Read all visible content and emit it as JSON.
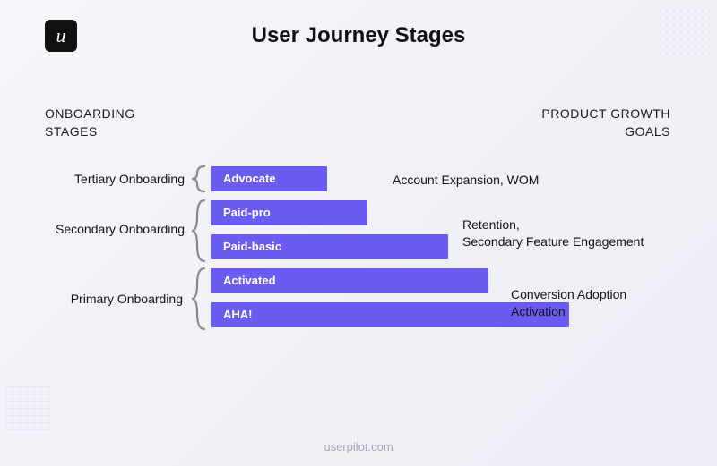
{
  "brand": {
    "logo_glyph": "u"
  },
  "title": "User Journey Stages",
  "columns": {
    "left": {
      "line1": "ONBOARDING",
      "line2": "STAGES"
    },
    "right": {
      "line1": "PRODUCT GROWTH",
      "line2": "GOALS"
    }
  },
  "stages": {
    "tertiary": "Tertiary Onboarding",
    "secondary": "Secondary Onboarding",
    "primary": "Primary Onboarding"
  },
  "goals": {
    "tertiary": "Account Expansion, WOM",
    "secondary_l1": "Retention,",
    "secondary_l2": "Secondary Feature Engagement",
    "primary_l1": "Conversion Adoption",
    "primary_l2": "Activation"
  },
  "footer": "userpilot.com",
  "chart_data": {
    "type": "bar",
    "title": "User Journey Stages",
    "xlabel": "",
    "ylabel": "",
    "categories": [
      "Advocate",
      "Paid-pro",
      "Paid-basic",
      "Activated",
      "AHA!"
    ],
    "values": [
      130,
      175,
      265,
      310,
      400
    ],
    "bar_color": "#6a5cf0",
    "groups": [
      {
        "stage": "Tertiary Onboarding",
        "bars": [
          "Advocate"
        ],
        "goal": "Account Expansion, WOM"
      },
      {
        "stage": "Secondary Onboarding",
        "bars": [
          "Paid-pro",
          "Paid-basic"
        ],
        "goal": "Retention, Secondary Feature Engagement"
      },
      {
        "stage": "Primary Onboarding",
        "bars": [
          "Activated",
          "AHA!"
        ],
        "goal": "Conversion Adoption Activation"
      }
    ]
  }
}
